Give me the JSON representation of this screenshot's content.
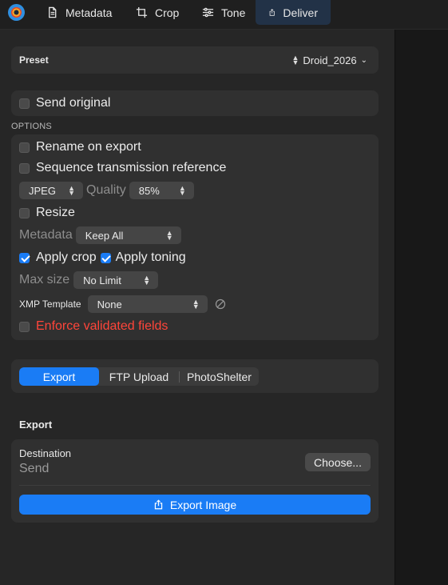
{
  "toolbar": {
    "tabs": [
      {
        "label": "Metadata",
        "icon": "document-icon",
        "active": false
      },
      {
        "label": "Crop",
        "icon": "crop-icon",
        "active": false
      },
      {
        "label": "Tone",
        "icon": "sliders-icon",
        "active": false
      },
      {
        "label": "Deliver",
        "icon": "share-icon",
        "active": true
      }
    ]
  },
  "preset": {
    "label": "Preset",
    "value": "Droid_2026"
  },
  "send_original": {
    "label": "Send original",
    "checked": false
  },
  "options": {
    "caption": "OPTIONS",
    "rename": {
      "label": "Rename on export",
      "checked": false
    },
    "sequence": {
      "label": "Sequence transmission reference",
      "checked": false
    },
    "format": {
      "value": "JPEG"
    },
    "quality": {
      "label": "Quality",
      "value": "85%"
    },
    "resize": {
      "label": "Resize",
      "checked": false
    },
    "metadata": {
      "label": "Metadata",
      "value": "Keep All"
    },
    "apply_crop": {
      "label": "Apply crop",
      "checked": true
    },
    "apply_toning": {
      "label": "Apply toning",
      "checked": true
    },
    "max_size": {
      "label": "Max size",
      "value": "No Limit"
    },
    "xmp": {
      "label": "XMP Template",
      "value": "None"
    },
    "enforce": {
      "label": "Enforce validated fields",
      "checked": false,
      "color": "#ff453a"
    }
  },
  "delivery_tabs": [
    "Export",
    "FTP Upload",
    "PhotoShelter"
  ],
  "export": {
    "heading": "Export",
    "destination_label": "Destination",
    "destination_value": "Send",
    "choose_label": "Choose...",
    "export_button": "Export Image"
  },
  "colors": {
    "accent": "#1a7cf5",
    "warning": "#ff453a"
  }
}
